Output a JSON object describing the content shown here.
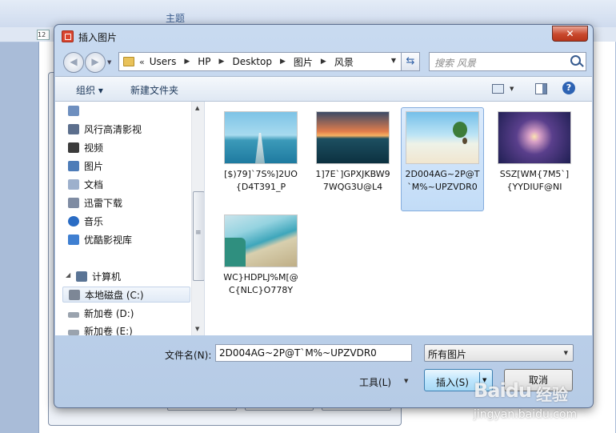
{
  "background_app": {
    "ribbon_label": "主题",
    "ruler_marker": "12"
  },
  "dialog": {
    "title": "插入图片",
    "close_glyph": "✕"
  },
  "address_bar": {
    "prefix": "«",
    "crumbs": [
      "Users",
      "HP",
      "Desktop",
      "图片",
      "风景"
    ],
    "separator": "▶",
    "search_placeholder": "搜索 风景"
  },
  "toolbar": {
    "organize_label": "组织 ▾",
    "new_folder_label": "新建文件夹"
  },
  "nav_pane": {
    "items": [
      {
        "label": "",
        "icon": "library-icon",
        "color": "#6e8fbf"
      },
      {
        "label": "风行高清影视",
        "icon": "video-lib-icon",
        "color": "#5c6f8d"
      },
      {
        "label": "视频",
        "icon": "video-icon",
        "color": "#3b3b3b"
      },
      {
        "label": "图片",
        "icon": "picture-icon",
        "color": "#4d7cb8"
      },
      {
        "label": "文档",
        "icon": "document-icon",
        "color": "#9db0cc"
      },
      {
        "label": "迅雷下载",
        "icon": "thunder-icon",
        "color": "#7f8ca3"
      },
      {
        "label": "音乐",
        "icon": "music-icon",
        "color": "#2a6cc4"
      },
      {
        "label": "优酷影视库",
        "icon": "youku-icon",
        "color": "#3f7fd1"
      },
      {
        "label": "计算机",
        "icon": "computer-icon",
        "color": "#5a7495"
      },
      {
        "label": "本地磁盘 (C:)",
        "icon": "system-drive-icon",
        "color": "#7d8796"
      },
      {
        "label": "新加卷 (D:)",
        "icon": "drive-icon",
        "color": "#9aa3ae"
      },
      {
        "label": "新加卷 (E:)",
        "icon": "drive-icon",
        "color": "#9aa3ae"
      }
    ]
  },
  "files": [
    {
      "name": "[$)79]`7S%]2UO{D4T391_P",
      "thumb": "pier"
    },
    {
      "name": "1]7E`]GPXJKBW97WQG3U@L4",
      "thumb": "sunset"
    },
    {
      "name": "2D004AG~2P@T`M%~UPZVDR0",
      "thumb": "beach-palm",
      "selected": true
    },
    {
      "name": "SSZ[WM{7M5`]{YYDIUF@NI",
      "thumb": "purple-sea"
    },
    {
      "name": "WC}HDPLJ%M[@C{NLC}O778Y",
      "thumb": "road-sea"
    }
  ],
  "bottom": {
    "filename_label": "文件名(N):",
    "filename_value": "2D004AG~2P@T`M%~UPZVDR0",
    "file_type": "所有图片",
    "tools_label": "工具(L)",
    "insert_label": "插入(S)",
    "cancel_label": "取消"
  },
  "watermark": {
    "logo": "Baidu",
    "text": "经验",
    "url": "jingyan.baidu.com"
  }
}
